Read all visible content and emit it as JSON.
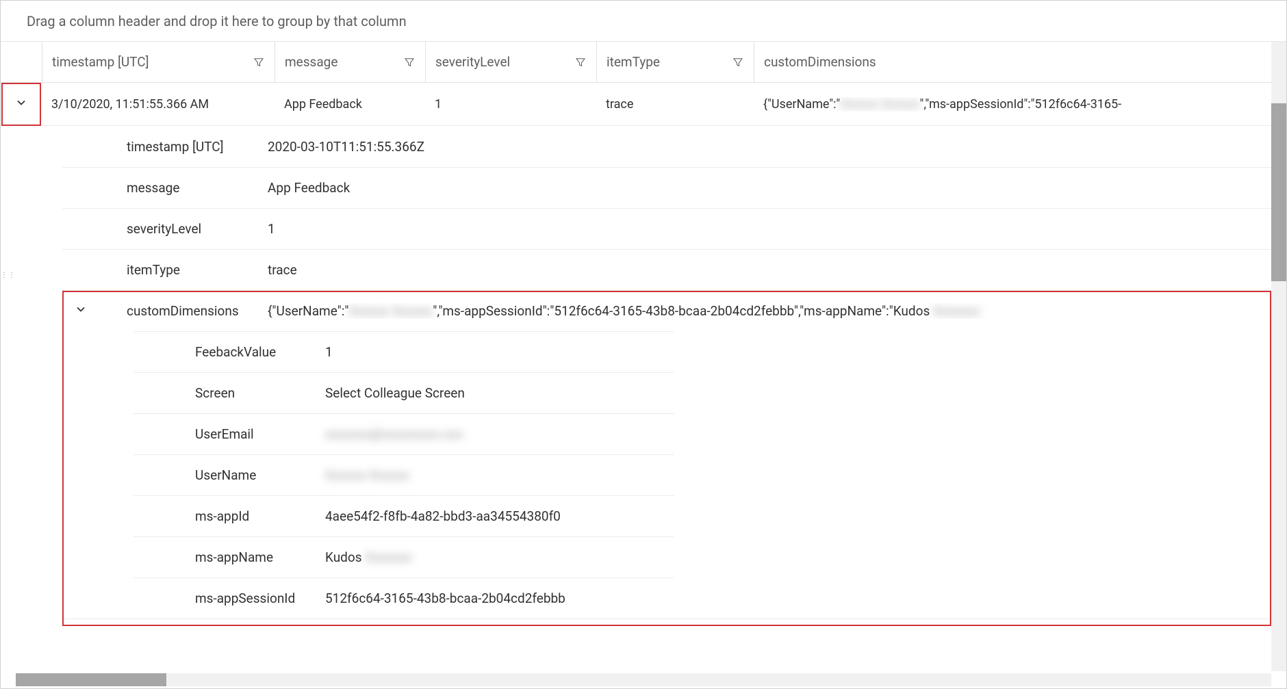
{
  "groupingHint": "Drag a column header and drop it here to group by that column",
  "columns": {
    "timestamp": "timestamp [UTC]",
    "message": "message",
    "severityLevel": "severityLevel",
    "itemType": "itemType",
    "customDimensions": "customDimensions"
  },
  "row": {
    "timestamp": "3/10/2020, 11:51:55.366 AM",
    "message": "App Feedback",
    "severityLevel": "1",
    "itemType": "trace",
    "customDimensionsPrefix": "{\"UserName\":\"",
    "customDimensionsBlur": "Xxxxxx Xxxxxx",
    "customDimensionsSuffix": "\",\"ms-appSessionId\":\"512f6c64-3165-"
  },
  "detail": {
    "timestamp_key": "timestamp [UTC]",
    "timestamp_val": "2020-03-10T11:51:55.366Z",
    "message_key": "message",
    "message_val": "App Feedback",
    "severity_key": "severityLevel",
    "severity_val": "1",
    "itemtype_key": "itemType",
    "itemtype_val": "trace",
    "custom_key": "customDimensions",
    "custom_prefix": "{\"UserName\":\"",
    "custom_blur": "Xxxxxx Xxxxxx",
    "custom_mid": "\",\"ms-appSessionId\":\"512f6c64-3165-43b8-bcaa-2b04cd2febbb\",\"ms-appName\":\"Kudos ",
    "custom_blur2": "Xxxxxxx"
  },
  "nested": {
    "feeback_key": "FeebackValue",
    "feeback_val": "1",
    "screen_key": "Screen",
    "screen_val": "Select Colleague Screen",
    "useremail_key": "UserEmail",
    "useremail_val": "xxxxxxx@xxxxxxxxx.xxx",
    "username_key": "UserName",
    "username_val": "Xxxxxx Xxxxxx",
    "appid_key": "ms-appId",
    "appid_val": "4aee54f2-f8fb-4a82-bbd3-aa34554380f0",
    "appname_key": "ms-appName",
    "appname_val_prefix": "Kudos ",
    "appname_val_blur": "Xxxxxxx",
    "sessionid_key": "ms-appSessionId",
    "sessionid_val": "512f6c64-3165-43b8-bcaa-2b04cd2febbb"
  }
}
